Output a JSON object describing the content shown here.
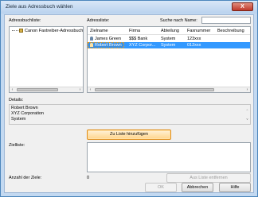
{
  "window": {
    "title": "Ziele aus Adressbuch wählen",
    "close_symbol": "X"
  },
  "labels": {
    "address_book_list": "Adressbuchliste:",
    "address_list": "Adressliste:",
    "search_by_name": "Suche nach Name:",
    "details": "Details:",
    "target_list": "Zielliste:",
    "target_count_label": "Anzahl der Ziele:",
    "target_count_value": "0"
  },
  "search": {
    "value": ""
  },
  "tree": {
    "item": "Canon Faxtreiber-Adressbuch"
  },
  "list": {
    "columns": [
      "Zielname",
      "Firma",
      "Abteilung",
      "Faxnummer",
      "Beschreibung"
    ],
    "rows": [
      [
        "James Green",
        "$$$ Bank",
        "System",
        "123xxx",
        ""
      ],
      [
        "Robert Brown",
        "XYZ Corpor...",
        "System",
        "012xxx",
        ""
      ]
    ],
    "selected_index": 1
  },
  "details": {
    "lines": [
      "Robert Brown",
      "XYZ Corporation",
      "System"
    ]
  },
  "buttons": {
    "add_to_list": "Zu Liste hinzufügen",
    "remove_from_list": "Aus Liste entfernen",
    "ok": "OK",
    "cancel": "Abbrechen",
    "help": "Hilfe"
  },
  "scrollbar": {
    "left_arrow": "‹",
    "right_arrow": "›",
    "up_arrow": "^",
    "down_arrow": "v"
  }
}
